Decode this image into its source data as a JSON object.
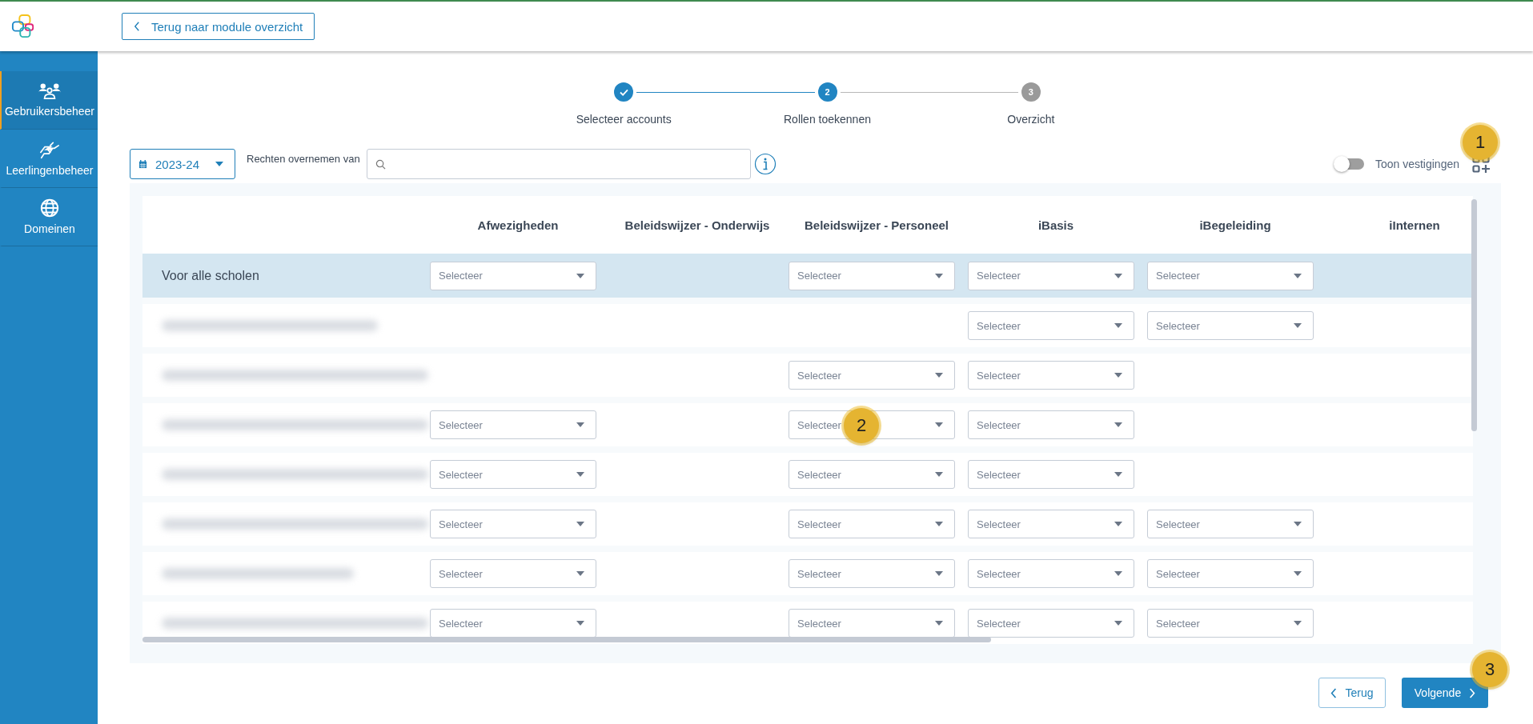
{
  "topbar": {
    "back_button": "Terug naar module overzicht"
  },
  "sidebar": {
    "items": [
      {
        "label": "Gebruikersbeheer",
        "selected": true
      },
      {
        "label": "Leerlingenbeheer",
        "selected": false
      },
      {
        "label": "Domeinen",
        "selected": false
      }
    ]
  },
  "stepper": {
    "steps": [
      {
        "label": "Selecteer accounts",
        "completed": true,
        "reached": true
      },
      {
        "label": "Rollen toekennen",
        "completed": false,
        "reached": true,
        "number": "2"
      },
      {
        "label": "Overzicht",
        "completed": false,
        "reached": false,
        "number": "3"
      }
    ]
  },
  "toolbar": {
    "year": "2023-24",
    "copy_label": "Rechten overnemen van",
    "toggle": {
      "label": "Toon vestigingen",
      "on": false
    },
    "callout": "1"
  },
  "table": {
    "columns": [
      "Afwezigheden",
      "Beleidswijzer - Onderwijs",
      "Beleidswijzer - Personeel",
      "iBasis",
      "iBegeleiding",
      "iInternen"
    ],
    "rows": [
      {
        "kind": "all",
        "label": "Voor alle scholen",
        "cells": [
          {
            "placeholder": "Selecteer"
          },
          null,
          {
            "placeholder": "Selecteer"
          },
          {
            "placeholder": "Selecteer"
          },
          {
            "placeholder": "Selecteer"
          },
          null
        ]
      },
      {
        "kind": "redacted",
        "cells": [
          null,
          null,
          null,
          {
            "placeholder": "Selecteer"
          },
          {
            "placeholder": "Selecteer"
          },
          null
        ]
      },
      {
        "kind": "redacted",
        "cells": [
          null,
          null,
          {
            "placeholder": "Selecteer"
          },
          {
            "placeholder": "Selecteer"
          },
          null,
          null
        ]
      },
      {
        "kind": "redacted",
        "cells": [
          {
            "placeholder": "Selecteer"
          },
          null,
          {
            "placeholder": "Selecteer",
            "callout": "2"
          },
          {
            "placeholder": "Selecteer"
          },
          null,
          null
        ]
      },
      {
        "kind": "redacted",
        "cells": [
          {
            "placeholder": "Selecteer"
          },
          null,
          {
            "placeholder": "Selecteer"
          },
          {
            "placeholder": "Selecteer"
          },
          null,
          null
        ]
      },
      {
        "kind": "redacted",
        "cells": [
          {
            "placeholder": "Selecteer"
          },
          null,
          {
            "placeholder": "Selecteer"
          },
          {
            "placeholder": "Selecteer"
          },
          {
            "placeholder": "Selecteer"
          },
          null
        ]
      },
      {
        "kind": "redacted",
        "cells": [
          {
            "placeholder": "Selecteer"
          },
          null,
          {
            "placeholder": "Selecteer"
          },
          {
            "placeholder": "Selecteer"
          },
          {
            "placeholder": "Selecteer"
          },
          null
        ]
      },
      {
        "kind": "redacted",
        "cells": [
          {
            "placeholder": "Selecteer"
          },
          null,
          {
            "placeholder": "Selecteer"
          },
          {
            "placeholder": "Selecteer"
          },
          {
            "placeholder": "Selecteer"
          },
          null
        ]
      }
    ]
  },
  "footer": {
    "back": "Terug",
    "next": "Volgende",
    "next_callout": "3"
  }
}
